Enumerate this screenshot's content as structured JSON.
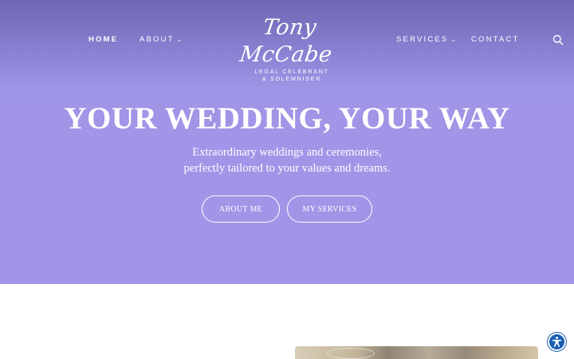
{
  "nav": {
    "home": "HOME",
    "about": "ABOUT",
    "services": "SERVICES",
    "contact": "CONTACT",
    "dropdown_glyph": "⌄",
    "search_icon": "search-icon"
  },
  "logo": {
    "name": "Tony McCabe",
    "line1": "LEGAL CELEBRANT",
    "line2": "& SOLEMNISER"
  },
  "hero": {
    "title": "YOUR WEDDING, YOUR WAY",
    "subtitle_line1": "Extraordinary weddings and ceremonies,",
    "subtitle_line2": "perfectly tailored to your values and dreams.",
    "button_about": "ABOUT ME",
    "button_services": "MY SERVICES"
  },
  "colors": {
    "hero_background": "#a195e8",
    "hero_top": "#6f67b3",
    "text": "#ffffff",
    "accessibility": "#1a5fb4"
  },
  "widgets": {
    "accessibility_icon": "accessibility-icon"
  }
}
